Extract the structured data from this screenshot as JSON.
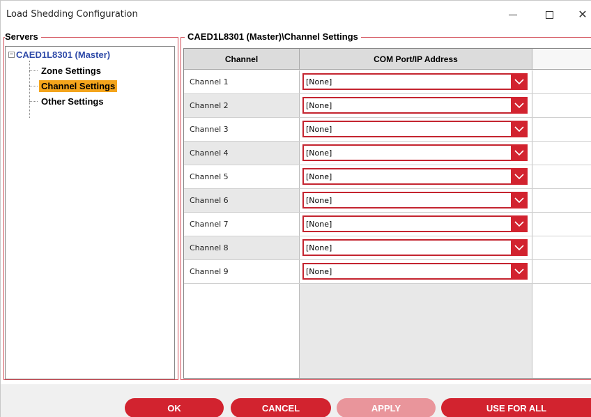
{
  "window": {
    "title": "Load Shedding Configuration",
    "minimize_glyph": "—",
    "close_glyph": "✕"
  },
  "servers": {
    "group_title": "Servers",
    "root_expander": "−",
    "root_label": "CAED1L8301 (Master)",
    "items": [
      {
        "label": "Zone Settings",
        "selected": false
      },
      {
        "label": "Channel Settings",
        "selected": true
      },
      {
        "label": "Other Settings",
        "selected": false
      }
    ]
  },
  "channels": {
    "group_title": "CAED1L8301 (Master)\\Channel Settings",
    "columns": [
      "Channel",
      "COM Port/IP Address"
    ],
    "rows": [
      {
        "channel": "Channel 1",
        "address": "[None]"
      },
      {
        "channel": "Channel 2",
        "address": "[None]"
      },
      {
        "channel": "Channel 3",
        "address": "[None]"
      },
      {
        "channel": "Channel 4",
        "address": "[None]"
      },
      {
        "channel": "Channel 5",
        "address": "[None]"
      },
      {
        "channel": "Channel 6",
        "address": "[None]"
      },
      {
        "channel": "Channel 7",
        "address": "[None]"
      },
      {
        "channel": "Channel 8",
        "address": "[None]"
      },
      {
        "channel": "Channel 9",
        "address": "[None]"
      }
    ]
  },
  "buttons": {
    "ok": "OK",
    "cancel": "CANCEL",
    "apply": "APPLY",
    "use_for_all": "USE FOR ALL"
  },
  "colors": {
    "accent_red": "#d2232f",
    "disabled_red": "#e9959b",
    "selection_orange": "#f4a51c",
    "root_blue": "#2e4aa8"
  }
}
